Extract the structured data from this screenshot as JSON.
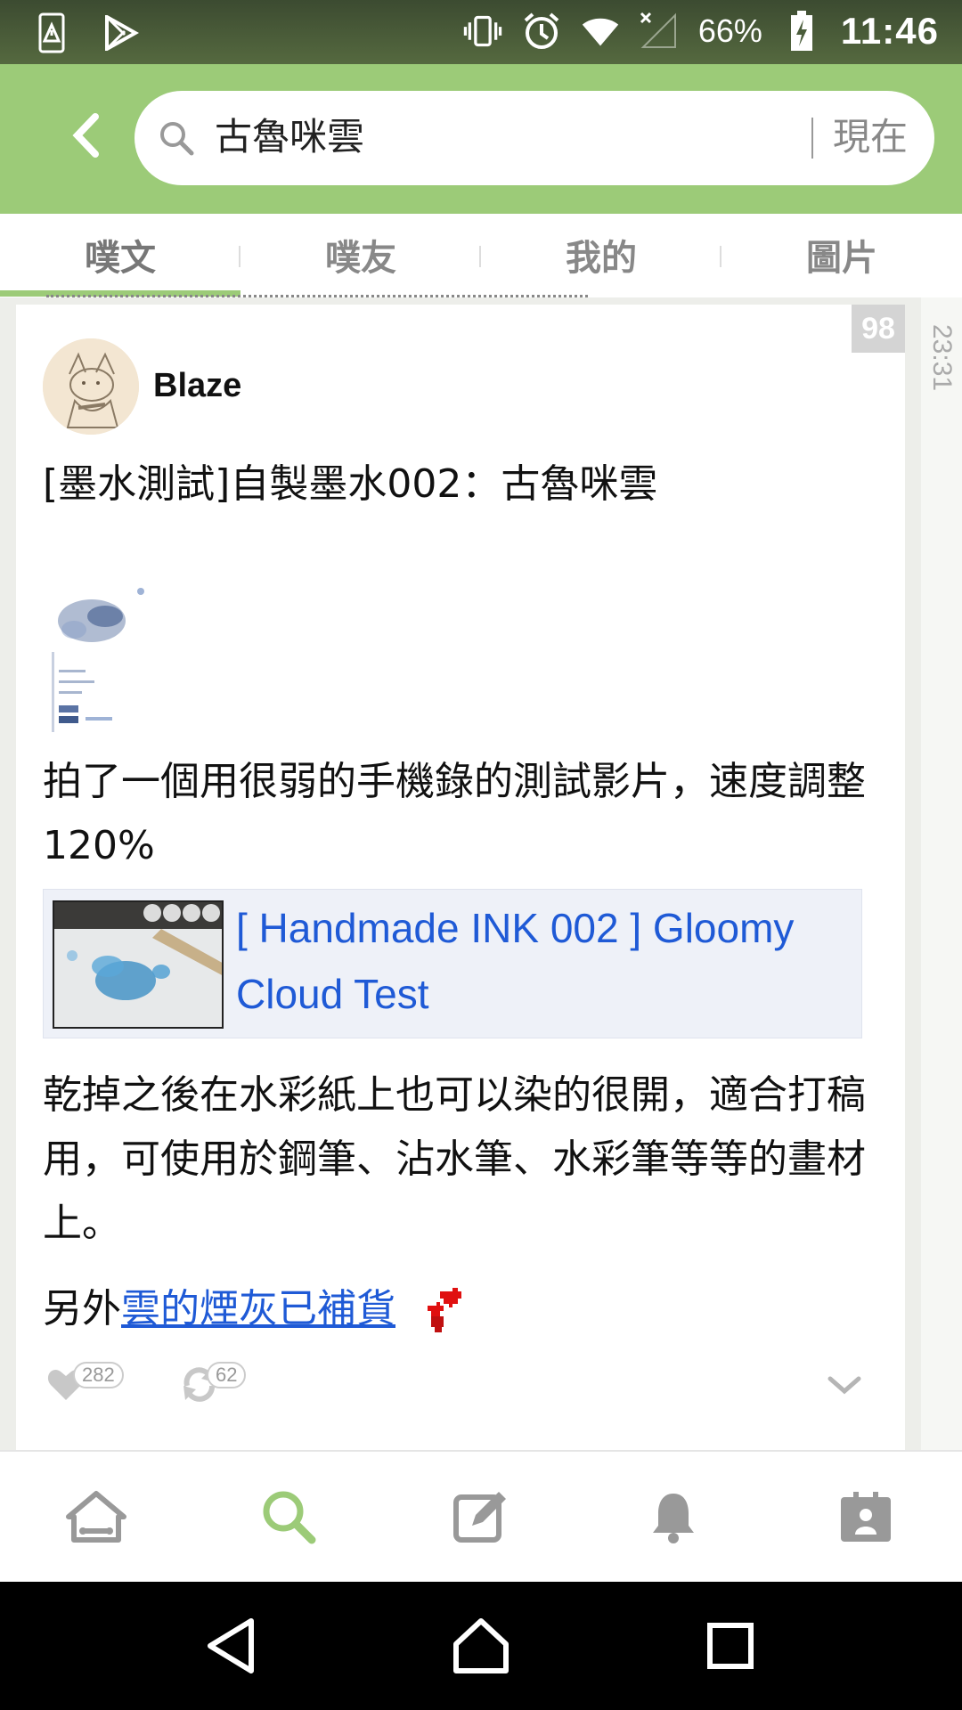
{
  "status_bar": {
    "battery_percent": "66%",
    "time": "11:46",
    "icons": [
      "sim-alert-icon",
      "play-store-icon",
      "vibrate-icon",
      "alarm-icon",
      "wifi-icon",
      "no-signal-icon",
      "battery-charging-icon"
    ]
  },
  "search": {
    "query": "古魯咪雲",
    "mode_label": "現在"
  },
  "tabs": [
    {
      "label": "噗文",
      "active": true
    },
    {
      "label": "噗友",
      "active": false
    },
    {
      "label": "我的",
      "active": false
    },
    {
      "label": "圖片",
      "active": false
    }
  ],
  "post": {
    "response_count": "98",
    "side_time": "23:31",
    "author": "Blaze",
    "title": "[墨水測試]自製墨水002：古魯咪雲",
    "para1": "拍了一個用很弱的手機錄的測試影片，速度調整120%",
    "video_title": "[ Handmade INK 002 ] Gloomy Cloud Test",
    "para2": "乾掉之後在水彩紙上也可以染的很開，適合打稿用，可使用於鋼筆、沾水筆、水彩筆等等的畫材上。",
    "para3_prefix": "另外",
    "para3_link": "雲的煙灰已補貨",
    "likes": "282",
    "replurks": "62"
  },
  "bottom_nav": [
    "home-icon",
    "search-icon",
    "compose-icon",
    "bell-icon",
    "profile-card-icon"
  ],
  "colors": {
    "brand_green": "#9ccb78",
    "link_blue": "#1f5ad6",
    "status_bar": "#4a5c3a"
  }
}
